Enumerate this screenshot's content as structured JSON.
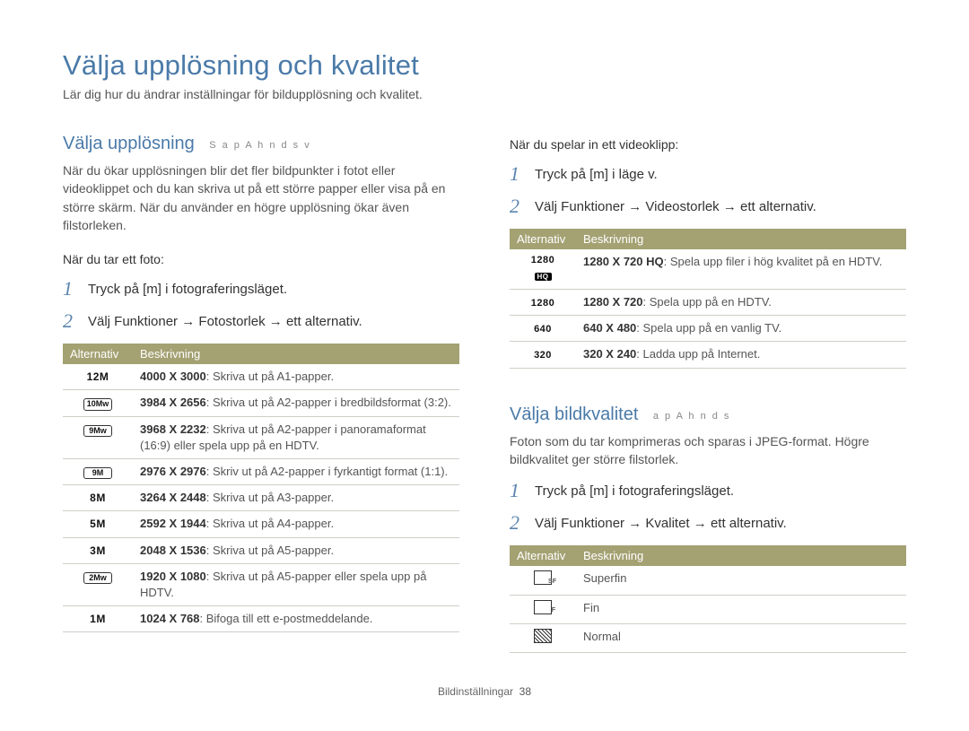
{
  "title": "Välja upplösning och kvalitet",
  "intro": "Lär dig hur du ändrar inställningar för bildupplösning och kvalitet.",
  "left": {
    "heading": "Välja upplösning",
    "modes": "S a p A h n d s v",
    "body": "När du ökar upplösningen blir det fler bildpunkter i fotot eller videoklippet och du kan skriva ut på ett större papper eller visa på en större skärm. När du använder en högre upplösning ökar även filstorleken.",
    "when_photo": "När du tar ett foto:",
    "step1": "Tryck på [m] i fotograferingsläget.",
    "step2_pre": "Välj Funktioner",
    "step2_mid": "Fotostorlek",
    "step2_post": "ett alternativ.",
    "table": {
      "h1": "Alternativ",
      "h2": "Beskrivning",
      "rows": [
        {
          "alt": "12M",
          "bold": "4000 X 3000",
          "rest": ": Skriva ut på A1-papper."
        },
        {
          "alt": "10Mw",
          "bold": "3984 X 2656",
          "rest": ": Skriva ut på A2-papper i bredbildsformat (3:2)."
        },
        {
          "alt": "9Mw",
          "bold": "3968 X 2232",
          "rest": ": Skriva ut på A2-papper i panoramaformat (16:9) eller spela upp på en HDTV."
        },
        {
          "alt": "9M",
          "bold": "2976 X 2976",
          "rest": ": Skriv ut på A2-papper i fyrkantigt format (1:1)."
        },
        {
          "alt": "8M",
          "bold": "3264 X 2448",
          "rest": ": Skriva ut på A3-papper."
        },
        {
          "alt": "5M",
          "bold": "2592 X 1944",
          "rest": ": Skriva ut på A4-papper."
        },
        {
          "alt": "3M",
          "bold": "2048 X 1536",
          "rest": ": Skriva ut på A5-papper."
        },
        {
          "alt": "2Mw",
          "bold": "1920 X 1080",
          "rest": ": Skriva ut på A5-papper eller spela upp på HDTV."
        },
        {
          "alt": "1M",
          "bold": "1024 X 768",
          "rest": ": Bifoga till ett e-postmeddelande."
        }
      ]
    }
  },
  "right": {
    "when_video": "När du spelar in ett videoklipp:",
    "vid_step1": "Tryck på [m] i läge v.",
    "vid_step2_pre": "Välj Funktioner",
    "vid_step2_mid": "Videostorlek",
    "vid_step2_post": "ett alternativ.",
    "vid_table": {
      "h1": "Alternativ",
      "h2": "Beskrivning",
      "rows": [
        {
          "alt": "1280HQ",
          "bold": "1280 X 720 HQ",
          "rest": ": Spela upp filer i hög kvalitet på en HDTV."
        },
        {
          "alt": "1280",
          "bold": "1280 X 720",
          "rest": ": Spela upp på en HDTV."
        },
        {
          "alt": "640",
          "bold": "640 X 480",
          "rest": ": Spela upp på en vanlig TV."
        },
        {
          "alt": "320",
          "bold": "320 X 240",
          "rest": ": Ladda upp på Internet."
        }
      ]
    },
    "q_heading": "Välja bildkvalitet",
    "q_modes": "a p A h n d s",
    "q_body": "Foton som du tar komprimeras och sparas i JPEG-format. Högre bildkvalitet ger större filstorlek.",
    "q_step1": "Tryck på [m] i fotograferingsläget.",
    "q_step2_pre": "Välj Funktioner",
    "q_step2_mid": "Kvalitet",
    "q_step2_post": "ett alternativ.",
    "q_table": {
      "h1": "Alternativ",
      "h2": "Beskrivning",
      "rows": [
        {
          "alt": "SF",
          "rest": "Superfin"
        },
        {
          "alt": "F",
          "rest": "Fin"
        },
        {
          "alt": "N",
          "rest": "Normal"
        }
      ]
    }
  },
  "footer": {
    "section": "Bildinställningar",
    "page": "38"
  }
}
